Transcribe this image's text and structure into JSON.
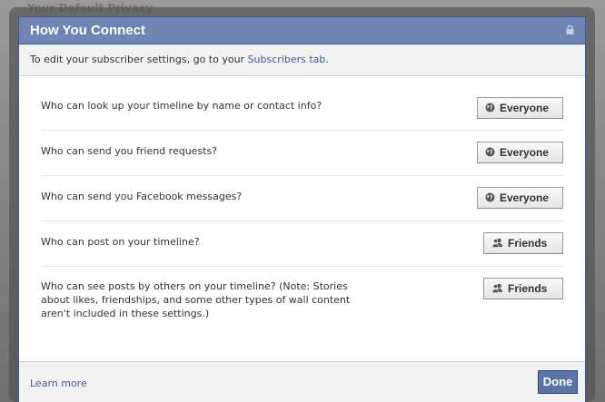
{
  "background": {
    "page_title": "Your Default Privacy"
  },
  "dialog": {
    "title": "How You Connect",
    "info_text": "To edit your subscriber settings, go to your ",
    "info_link": "Subscribers tab",
    "info_suffix": ".",
    "settings": [
      {
        "question": "Who can look up your timeline by name or contact info?",
        "value": "Everyone",
        "icon": "globe-icon"
      },
      {
        "question": "Who can send you friend requests?",
        "value": "Everyone",
        "icon": "globe-icon"
      },
      {
        "question": "Who can send you Facebook messages?",
        "value": "Everyone",
        "icon": "globe-icon"
      },
      {
        "question": "Who can post on your timeline?",
        "value": "Friends",
        "icon": "friends-icon"
      },
      {
        "question": "Who can see posts by others on your timeline? (Note: Stories about likes, friendships, and some other types of wall content aren't included in these settings.)",
        "value": "Friends",
        "icon": "friends-icon"
      }
    ],
    "footer": {
      "learn_more": "Learn more",
      "done": "Done"
    }
  },
  "colors": {
    "header": "#6d84b4",
    "border": "#3b5998",
    "link": "#3b5998",
    "button": "#5b74a8"
  }
}
